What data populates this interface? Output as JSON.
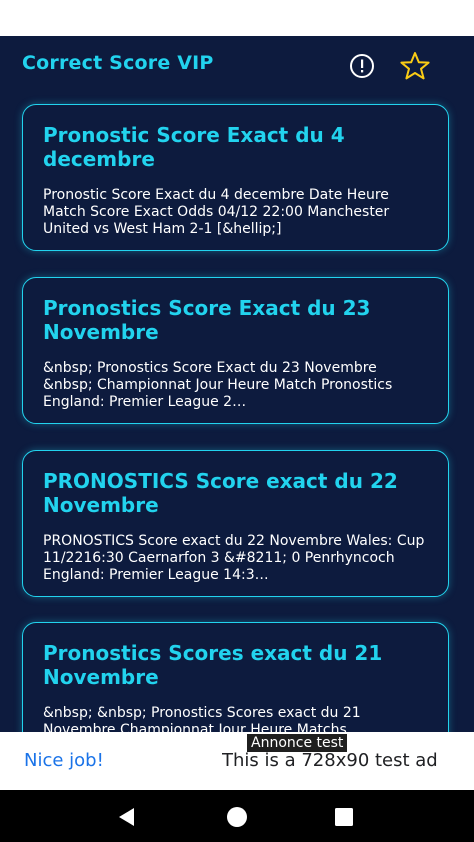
{
  "app_bar": {
    "title": "Correct Score VIP",
    "info_icon": "info-circle-icon",
    "star_icon": "star-outline-icon",
    "accent_color": "#22d3ee",
    "background_color": "#0d1b3e"
  },
  "posts": [
    {
      "title": "Pronostic Score Exact du 4 decembre",
      "excerpt": "Pronostic Score Exact du 4 decembre Date Heure Match Score Exact Odds 04/12 22:00 Manchester United vs West Ham 2-1 [&hellip;]"
    },
    {
      "title": "Pronostics Score Exact du 23 Novembre",
      "excerpt": "&nbsp; Pronostics Score Exact du 23 Novembre &nbsp; Championnat Jour Heure Match Pronostics England: Premier League 2…"
    },
    {
      "title": "PRONOSTICS Score exact du 22 Novembre",
      "excerpt": "PRONOSTICS Score exact du 22 Novembre Wales: Cup 11/2216:30 Caernarfon 3 &#8211; 0 Penrhyncoch England: Premier League 14:3…"
    },
    {
      "title": "Pronostics Scores exact du 21 Novembre",
      "excerpt": "&nbsp; &nbsp; Pronostics Scores exact du 21 Novembre Championnat Jour Heure Matchs"
    }
  ],
  "ad": {
    "label": "Annonce test",
    "left_text": "Nice job!",
    "right_text": "This is a 728x90 test ad"
  },
  "nav": {
    "back_icon": "back-triangle-icon",
    "home_icon": "home-circle-icon",
    "recent_icon": "recent-apps-square-icon"
  }
}
